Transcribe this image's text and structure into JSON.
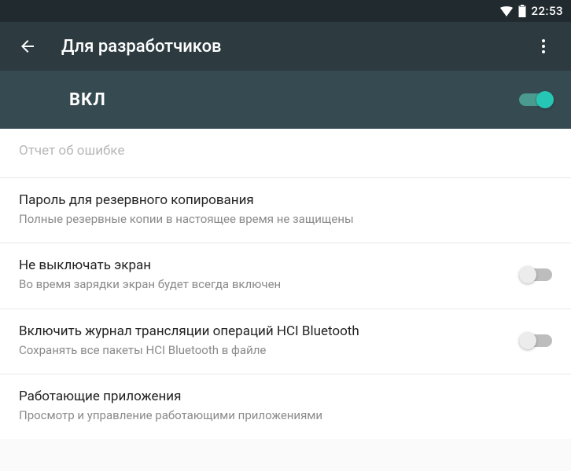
{
  "status": {
    "time": "22:53"
  },
  "toolbar": {
    "title": "Для разработчиков"
  },
  "master": {
    "label": "ВКЛ",
    "on": true
  },
  "rows": [
    {
      "primary": "Отчет об ошибке",
      "secondary": "",
      "disabled": true,
      "switch": null
    },
    {
      "primary": "Пароль для резервного копирования",
      "secondary": "Полные резервные копии в настоящее время не защищены",
      "disabled": false,
      "switch": null
    },
    {
      "primary": "Не выключать экран",
      "secondary": "Во время зарядки экран будет всегда включен",
      "disabled": false,
      "switch": false
    },
    {
      "primary": "Включить журнал трансляции операций HCI Bluetooth",
      "secondary": "Сохранять все пакеты HCI Bluetooth в файле",
      "disabled": false,
      "switch": false
    },
    {
      "primary": "Работающие приложения",
      "secondary": "Просмотр и управление работающими приложениями",
      "disabled": false,
      "switch": null
    }
  ]
}
